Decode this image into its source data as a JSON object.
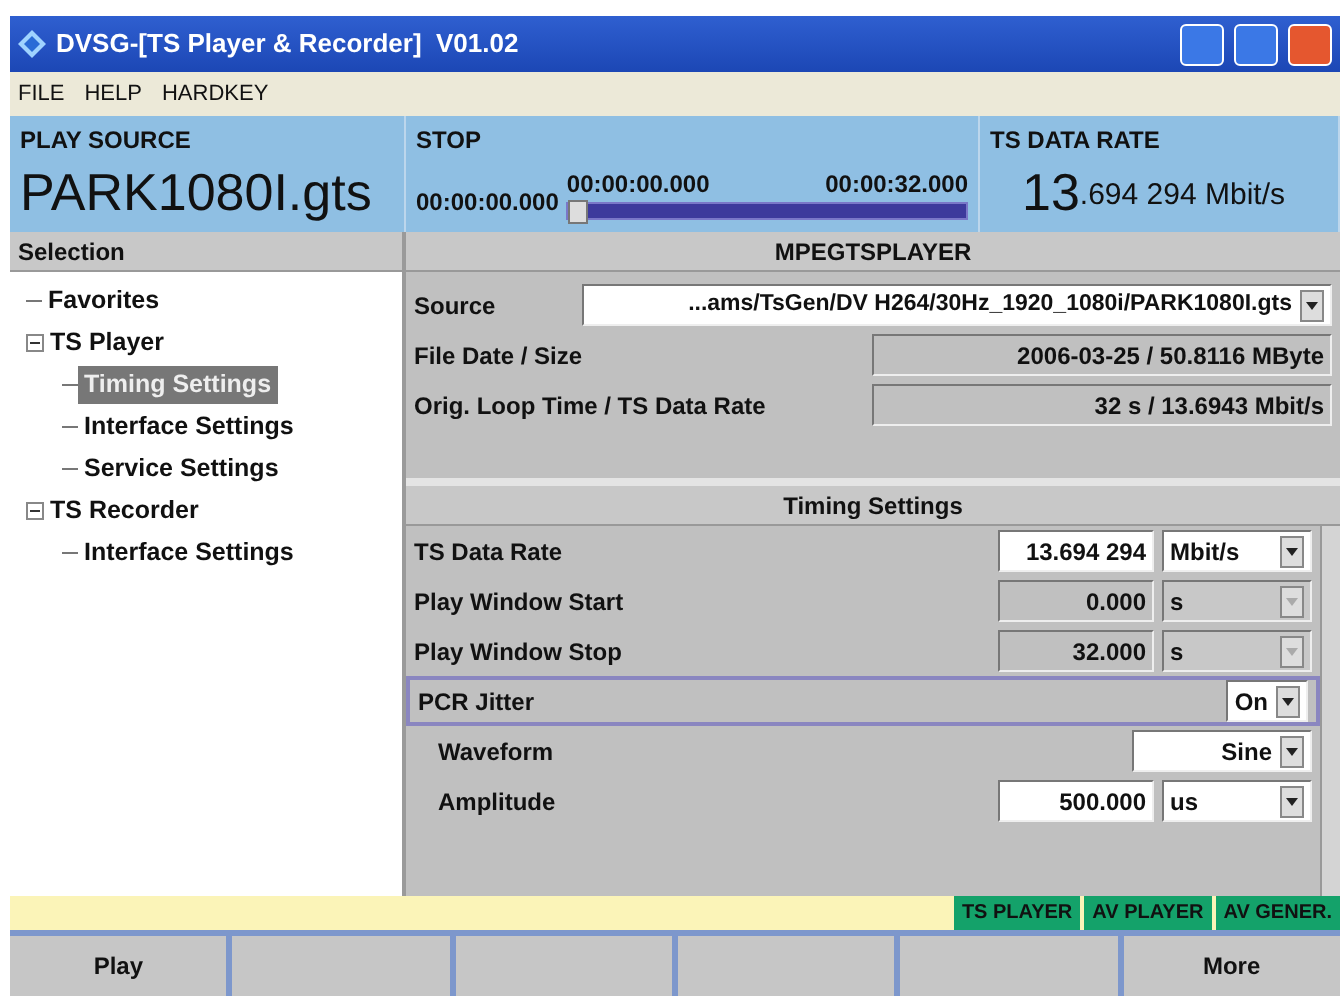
{
  "window": {
    "title": "DVSG-[TS Player & Recorder]  V01.02"
  },
  "menu": [
    "FILE",
    "HELP",
    "HARDKEY"
  ],
  "header": {
    "play_source": {
      "label": "PLAY SOURCE",
      "value": "PARK1080I.gts"
    },
    "transport": {
      "label": "STOP",
      "start": "00:00:00.000",
      "position": "00:00:00.000",
      "end": "00:00:32.000",
      "level": 0
    },
    "data_rate": {
      "label": "TS DATA RATE",
      "value_major": "13",
      "value_minor": ".694 294 Mbit/s"
    }
  },
  "selection": {
    "title": "Selection",
    "tree": [
      {
        "label": "Favorites",
        "selected": false
      },
      {
        "label": "TS Player",
        "expanded": true,
        "selected": false,
        "children": [
          {
            "label": "Timing Settings",
            "selected": true
          },
          {
            "label": "Interface Settings",
            "selected": false
          },
          {
            "label": "Service Settings",
            "selected": false
          }
        ]
      },
      {
        "label": "TS Recorder",
        "expanded": true,
        "selected": false,
        "children": [
          {
            "label": "Interface Settings",
            "selected": false
          }
        ]
      }
    ]
  },
  "player": {
    "title": "MPEGTSPLAYER",
    "source": {
      "label": "Source",
      "value": "...ams/TsGen/DV H264/30Hz_1920_1080i/PARK1080I.gts"
    },
    "info": [
      {
        "label": "File Date / Size",
        "value": "2006-03-25 / 50.8116 MByte"
      },
      {
        "label": "Orig. Loop Time / TS Data Rate",
        "value": "32 s / 13.6943 Mbit/s"
      }
    ]
  },
  "timing": {
    "title": "Timing Settings",
    "rows": [
      {
        "label": "TS Data Rate",
        "kind": "number",
        "value": "13.694 294",
        "unit": "Mbit/s",
        "disabled": false,
        "selected": false
      },
      {
        "label": "Play Window Start",
        "kind": "number",
        "value": "0.000",
        "unit": "s",
        "disabled": true,
        "selected": false
      },
      {
        "label": "Play Window Stop",
        "kind": "number",
        "value": "32.000",
        "unit": "s",
        "disabled": true,
        "selected": false
      },
      {
        "label": "PCR Jitter",
        "kind": "choice",
        "value": "On",
        "disabled": false,
        "selected": true,
        "children": [
          {
            "label": "Waveform",
            "kind": "choice",
            "value": "Sine",
            "disabled": false,
            "selected": false
          },
          {
            "label": "Amplitude",
            "kind": "number",
            "value": "500.000",
            "unit": "us",
            "disabled": false,
            "selected": false
          }
        ]
      }
    ]
  },
  "status_tags": [
    "TS PLAYER",
    "AV PLAYER",
    "AV GENER."
  ],
  "softkeys": {
    "first": "Play",
    "last": "More"
  }
}
